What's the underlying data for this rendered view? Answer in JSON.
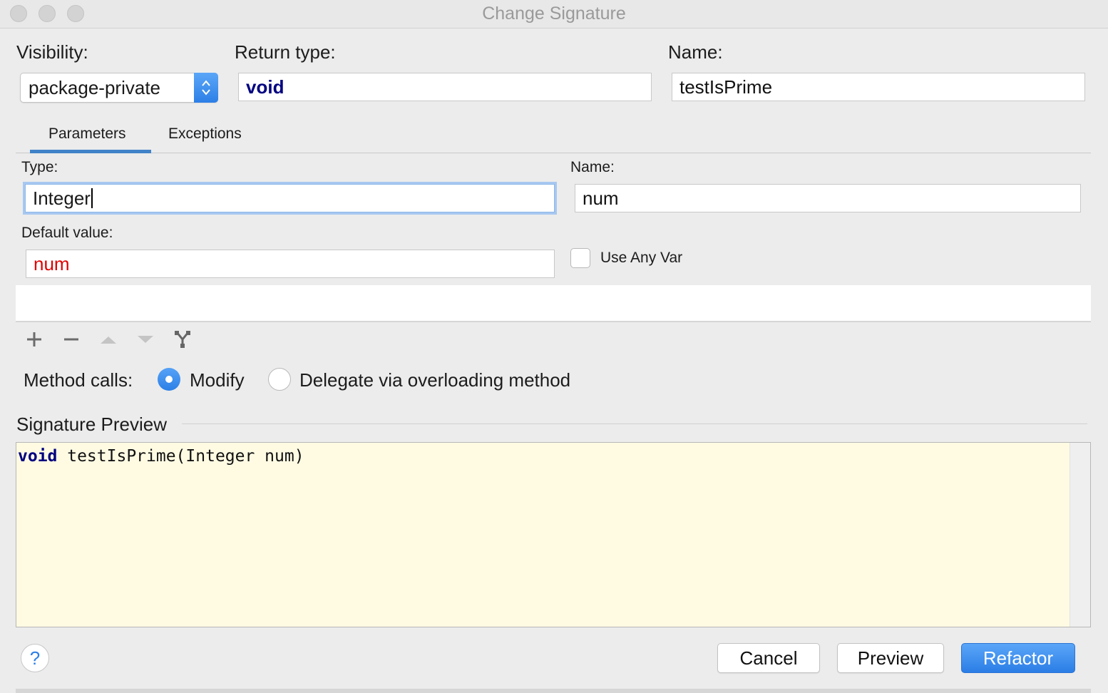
{
  "window": {
    "title": "Change Signature"
  },
  "signature": {
    "visibility_label": "Visibility:",
    "visibility_value": "package-private",
    "return_type_label": "Return type:",
    "return_type_value": "void",
    "name_label": "Name:",
    "name_value": "testIsPrime"
  },
  "tabs": [
    {
      "label": "Parameters",
      "selected": true
    },
    {
      "label": "Exceptions",
      "selected": false
    }
  ],
  "parameter": {
    "type_label": "Type:",
    "type_value": "Integer",
    "name_label": "Name:",
    "name_value": "num",
    "default_label": "Default value:",
    "default_value": "num",
    "use_any_var_label": "Use Any Var",
    "use_any_var_checked": false
  },
  "toolbar": {
    "icons": [
      "plus-icon",
      "minus-icon",
      "move-up-icon",
      "move-down-icon",
      "propagate-icon"
    ]
  },
  "method_calls": {
    "label": "Method calls:",
    "options": [
      {
        "label": "Modify",
        "selected": true
      },
      {
        "label": "Delegate via overloading method",
        "selected": false
      }
    ]
  },
  "preview": {
    "title": "Signature Preview",
    "keyword": "void",
    "rest": " testIsPrime(Integer num)"
  },
  "buttons": {
    "help": "?",
    "cancel": "Cancel",
    "preview": "Preview",
    "refactor": "Refactor"
  },
  "colors": {
    "accent": "#2c7fe6",
    "keyword": "#000080",
    "error_text": "#e00000",
    "preview_bg": "#fffbe3"
  }
}
